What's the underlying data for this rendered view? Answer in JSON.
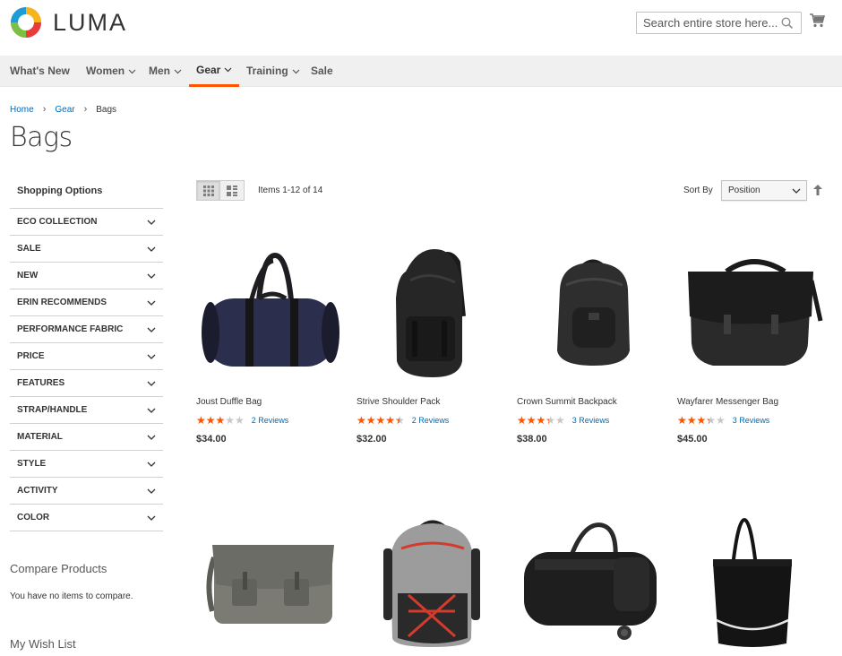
{
  "header": {
    "logo_text": "LUMA",
    "search_placeholder": "Search entire store here...",
    "brand_color": "#ff5501"
  },
  "nav": {
    "items": [
      {
        "label": "What's New",
        "has_dropdown": false
      },
      {
        "label": "Women",
        "has_dropdown": true
      },
      {
        "label": "Men",
        "has_dropdown": true
      },
      {
        "label": "Gear",
        "has_dropdown": true,
        "active": true
      },
      {
        "label": "Training",
        "has_dropdown": true
      },
      {
        "label": "Sale",
        "has_dropdown": false
      }
    ]
  },
  "breadcrumb": {
    "items": [
      "Home",
      "Gear",
      "Bags"
    ]
  },
  "page_title": "Bags",
  "sidebar": {
    "filters_title": "Shopping Options",
    "filters": [
      "ECO COLLECTION",
      "SALE",
      "NEW",
      "ERIN RECOMMENDS",
      "PERFORMANCE FABRIC",
      "PRICE",
      "FEATURES",
      "STRAP/HANDLE",
      "MATERIAL",
      "STYLE",
      "ACTIVITY",
      "COLOR"
    ],
    "compare_title": "Compare Products",
    "compare_text": "You have no items to compare.",
    "wishlist_title": "My Wish List"
  },
  "toolbar": {
    "items_count": "Items 1-12 of 14",
    "sort_label": "Sort By",
    "sort_value": "Position"
  },
  "products": [
    {
      "name": "Joust Duffle Bag",
      "rating": 60,
      "reviews": "2 Reviews",
      "price": "$34.00",
      "icon": "duffle-bag"
    },
    {
      "name": "Strive Shoulder Pack",
      "rating": 90,
      "reviews": "2 Reviews",
      "price": "$32.00",
      "icon": "sling-pack"
    },
    {
      "name": "Crown Summit Backpack",
      "rating": 67,
      "reviews": "3 Reviews",
      "price": "$38.00",
      "icon": "backpack"
    },
    {
      "name": "Wayfarer Messenger Bag",
      "rating": 67,
      "reviews": "3 Reviews",
      "price": "$45.00",
      "icon": "messenger-bag"
    },
    {
      "icon": "gray-messenger-bag"
    },
    {
      "icon": "gray-backpack"
    },
    {
      "icon": "rolling-duffle"
    },
    {
      "icon": "tote-bag"
    }
  ]
}
